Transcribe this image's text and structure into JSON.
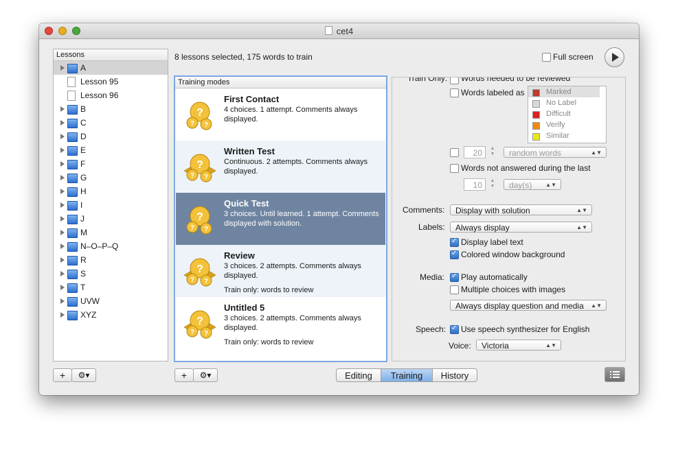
{
  "window": {
    "title": "cet4"
  },
  "header": {
    "status": "8 lessons selected, 175 words to train",
    "fullscreen_label": "Full screen"
  },
  "lessons": {
    "header": "Lessons",
    "items": [
      {
        "label": "A",
        "type": "folder"
      },
      {
        "label": "Lesson 95",
        "type": "page"
      },
      {
        "label": "Lesson 96",
        "type": "page"
      },
      {
        "label": "B",
        "type": "folder"
      },
      {
        "label": "C",
        "type": "folder"
      },
      {
        "label": "D",
        "type": "folder"
      },
      {
        "label": "E",
        "type": "folder"
      },
      {
        "label": "F",
        "type": "folder"
      },
      {
        "label": "G",
        "type": "folder"
      },
      {
        "label": "H",
        "type": "folder"
      },
      {
        "label": "I",
        "type": "folder"
      },
      {
        "label": "J",
        "type": "folder"
      },
      {
        "label": "M",
        "type": "folder"
      },
      {
        "label": "N–O–P–Q",
        "type": "folder"
      },
      {
        "label": "R",
        "type": "folder"
      },
      {
        "label": "S",
        "type": "folder"
      },
      {
        "label": "T",
        "type": "folder"
      },
      {
        "label": "UVW",
        "type": "folder"
      },
      {
        "label": "XYZ",
        "type": "folder"
      }
    ]
  },
  "modes": {
    "header": "Training modes",
    "items": [
      {
        "title": "First Contact",
        "desc": "4 choices. 1 attempt. Comments always displayed.",
        "extra": ""
      },
      {
        "title": "Written Test",
        "desc": "Continuous. 2 attempts. Comments always displayed.",
        "extra": ""
      },
      {
        "title": "Quick Test",
        "desc": "3 choices. Until learned. 1 attempt. Comments displayed with solution.",
        "extra": ""
      },
      {
        "title": "Review",
        "desc": "3 choices. 2 attempts. Comments always displayed.",
        "extra": "Train only: words to review"
      },
      {
        "title": "Untitled 5",
        "desc": "3 choices. 2 attempts. Comments always displayed.",
        "extra": "Train only: words to review"
      }
    ]
  },
  "settings": {
    "train_only_label": "Train Only:",
    "words_needed": "Words needed to be reviewed",
    "words_labeled": "Words labeled as",
    "label_list": [
      {
        "name": "Marked",
        "color": "#c0392b"
      },
      {
        "name": "No Label",
        "color": "#d8d8d8"
      },
      {
        "name": "Difficult",
        "color": "#e02020"
      },
      {
        "name": "Verify",
        "color": "#f08a10"
      },
      {
        "name": "Similar",
        "color": "#e8e820"
      }
    ],
    "random_count": "20",
    "random_popup": "random words",
    "not_answered": "Words not answered during the last",
    "days_count": "10",
    "days_popup": "day(s)",
    "comments_label": "Comments:",
    "comments_value": "Display with solution",
    "labels_label": "Labels:",
    "labels_value": "Always display",
    "display_label_text": "Display label text",
    "colored_bg": "Colored window background",
    "media_label": "Media:",
    "play_auto": "Play automatically",
    "multi_images": "Multiple choices with images",
    "media_popup": "Always display question and media",
    "speech_label": "Speech:",
    "speech_check": "Use speech synthesizer for English",
    "voice_label": "Voice:",
    "voice_value": "Victoria"
  },
  "tabs": [
    "Editing",
    "Training",
    "History"
  ],
  "colors": {
    "selection": "#6f84a0",
    "tab_selected": "#8ab8ea",
    "close": "#e5473c",
    "minimize": "#e8b021",
    "zoom": "#4aa83c"
  }
}
